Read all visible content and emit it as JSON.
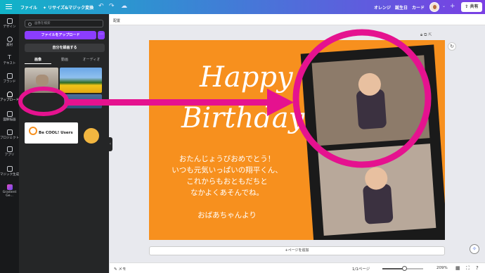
{
  "topbar": {
    "file_label": "ファイル",
    "resize_label": "リサイズ&マジック変換",
    "project_name": "オレンジ　誕生日　カード",
    "share_label": "共有"
  },
  "rail": [
    {
      "label": "デザイン",
      "icon": "layout-icon"
    },
    {
      "label": "素材",
      "icon": "shapes-icon"
    },
    {
      "label": "テキスト",
      "icon": "text-icon"
    },
    {
      "label": "ブランド",
      "icon": "brand-icon"
    },
    {
      "label": "アップロード",
      "icon": "upload-cloud-icon"
    },
    {
      "label": "図解描画",
      "icon": "draw-icon"
    },
    {
      "label": "プロジェクト",
      "icon": "folder-icon"
    },
    {
      "label": "アプリ",
      "icon": "apps-icon"
    },
    {
      "label": "マジック生成",
      "icon": "magic-icon"
    },
    {
      "label": "Gradient Ge...",
      "icon": "gradient-app-icon"
    }
  ],
  "panel": {
    "search_placeholder": "画像を検索",
    "upload_label": "ファイルをアップロード",
    "more_label": "⋯",
    "record_label": "自分を録画する",
    "tabs": [
      "画像",
      "動画",
      "オーディオ"
    ],
    "logo_small_text": "Be COOL! Users"
  },
  "canvas": {
    "toolbar_label": "配置",
    "happy": "Happy",
    "birthday": "Birthday!",
    "message_lines": [
      "おたんじょうびおめでとう！",
      "いつも元気いっぱいの翔平くん、",
      "これからもおともだちと",
      "なかよくあそんでね。"
    ],
    "signature": "おばあちゃんより",
    "add_page_label": "+ページを追加"
  },
  "bottombar": {
    "notes_label": "メモ",
    "page_label": "1/1ページ",
    "zoom_label": "209%"
  },
  "zoom_fraction": 0.55,
  "colors": {
    "highlight": "#e5128f",
    "card": "#f7901e",
    "accent": "#8b3dff"
  }
}
